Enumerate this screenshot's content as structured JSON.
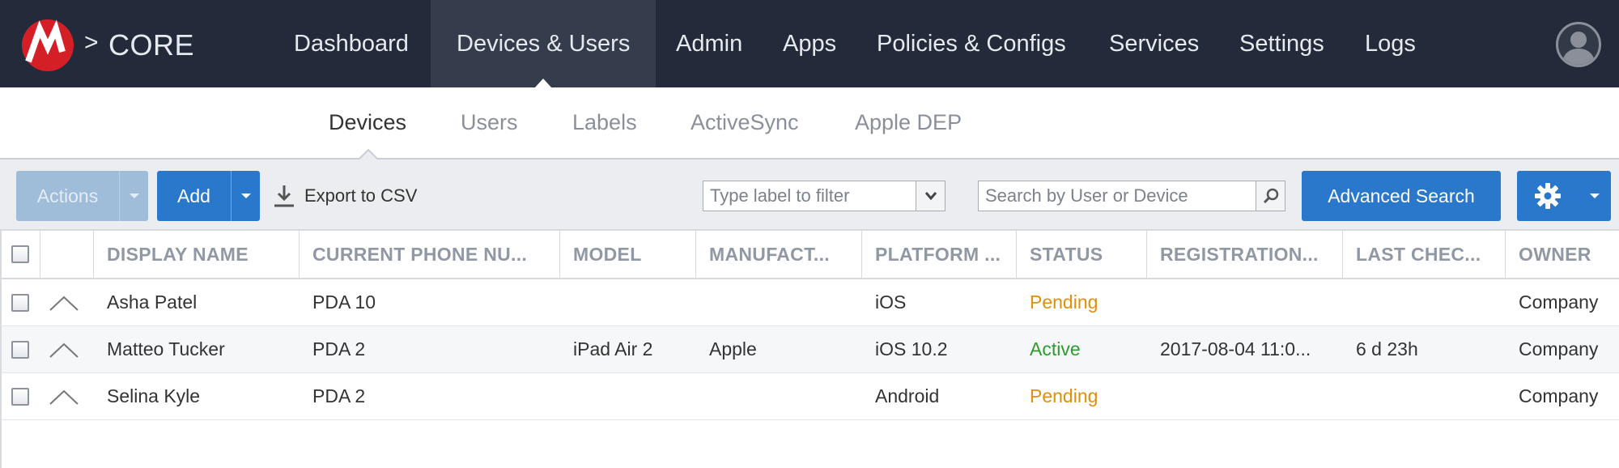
{
  "header": {
    "brand": "CORE",
    "separator": ">",
    "nav": [
      {
        "label": "Dashboard",
        "active": false
      },
      {
        "label": "Devices & Users",
        "active": true
      },
      {
        "label": "Admin",
        "active": false
      },
      {
        "label": "Apps",
        "active": false
      },
      {
        "label": "Policies & Configs",
        "active": false
      },
      {
        "label": "Services",
        "active": false
      },
      {
        "label": "Settings",
        "active": false
      },
      {
        "label": "Logs",
        "active": false
      }
    ],
    "avatar_icon": "user-avatar-icon"
  },
  "subnav": {
    "items": [
      {
        "label": "Devices",
        "active": true
      },
      {
        "label": "Users",
        "active": false
      },
      {
        "label": "Labels",
        "active": false
      },
      {
        "label": "ActiveSync",
        "active": false
      },
      {
        "label": "Apple DEP",
        "active": false
      }
    ]
  },
  "toolbar": {
    "actions_label": "Actions",
    "add_label": "Add",
    "export_label": "Export to CSV",
    "label_filter_placeholder": "Type label to filter",
    "search_placeholder": "Search by User or Device",
    "advanced_search_label": "Advanced Search",
    "gear_icon": "gear-icon"
  },
  "table": {
    "columns": [
      "DISPLAY NAME",
      "CURRENT PHONE NU...",
      "MODEL",
      "MANUFACT...",
      "PLATFORM ...",
      "STATUS",
      "REGISTRATION...",
      "LAST CHEC...",
      "OWNER"
    ],
    "rows": [
      {
        "display_name": "Asha Patel",
        "phone": "PDA 10",
        "model": "",
        "manufacturer": "",
        "platform": "iOS",
        "status": "Pending",
        "registration": "",
        "last_check": "",
        "owner": "Company"
      },
      {
        "display_name": "Matteo Tucker",
        "phone": "PDA 2",
        "model": "iPad Air 2",
        "manufacturer": "Apple",
        "platform": "iOS 10.2",
        "status": "Active",
        "registration": "2017-08-04 11:0...",
        "last_check": "6 d 23h",
        "owner": "Company"
      },
      {
        "display_name": "Selina Kyle",
        "phone": "PDA 2",
        "model": "",
        "manufacturer": "",
        "platform": "Android",
        "status": "Pending",
        "registration": "",
        "last_check": "",
        "owner": "Company"
      }
    ]
  },
  "colors": {
    "nav_bg": "#232b3a",
    "primary": "#2a78cc",
    "pending": "#e08f0b",
    "active": "#2e9b2e",
    "logo": "#d51f26"
  }
}
